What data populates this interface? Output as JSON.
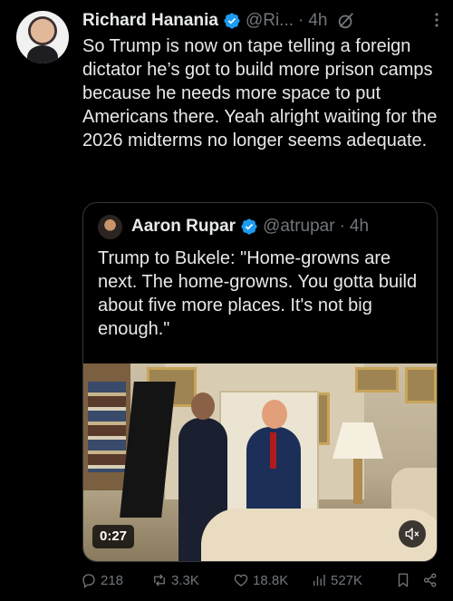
{
  "author": {
    "name": "Richard Hanania",
    "handle": "@Ri...",
    "separator": "·",
    "time": "4h"
  },
  "tweet": {
    "text": "So Trump is now on tape telling a foreign dictator he’s got to build more prison camps because he needs more space to put Americans there. Yeah alright waiting for the 2026 midterms no longer seems adequate."
  },
  "quote": {
    "name": "Aaron Rupar",
    "handle": "@atrupar",
    "separator": "·",
    "time": "4h",
    "text": "Trump to Bukele: \"Home-growns are next. The home-growns. You gotta build about five more places. It's not big enough.\"",
    "video": {
      "duration": "0:27",
      "muted": true
    }
  },
  "actions": {
    "replies": "218",
    "reposts": "3.3K",
    "likes": "18.8K",
    "views": "527K"
  },
  "colors": {
    "background": "#000000",
    "text": "#e7e9ea",
    "muted": "#71767b",
    "verified": "#1d9bf0",
    "border": "#333639"
  }
}
